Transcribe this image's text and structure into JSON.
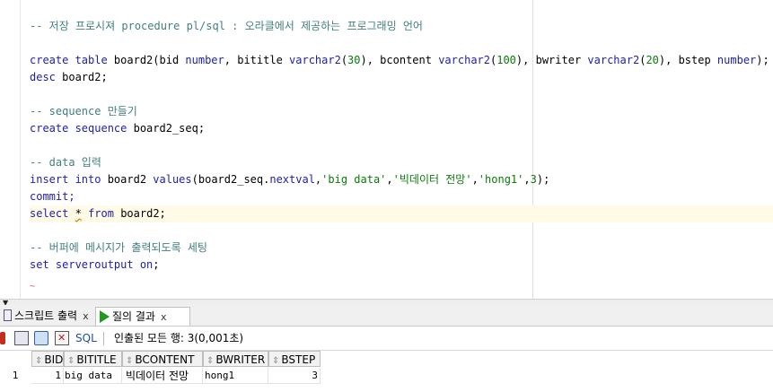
{
  "editor": {
    "lines": {
      "c1": "-- 저장 프로시져 procedure pl/sql : 오라클에서 제공하는 프로그래밍 언어",
      "l2a": "create table",
      "l2b": " board2(bid ",
      "l2c": "number",
      "l2d": ", bititle ",
      "l2e": "varchar2",
      "l2f": "(",
      "l2g": "30",
      "l2h": "), bcontent ",
      "l2i": "varchar2",
      "l2j": "(",
      "l2k": "100",
      "l2l": "), bwriter ",
      "l2m": "varchar2",
      "l2n": "(",
      "l2o": "20",
      "l2p": "), bstep ",
      "l2q": "number",
      "l2r": ");",
      "l3a": "desc",
      "l3b": " board2;",
      "c2": "-- sequence 만들기",
      "l4a": "create sequence",
      "l4b": " board2_seq;",
      "c3": "-- data 입력",
      "l5a": "insert into",
      "l5b": " board2 ",
      "l5c": "values",
      "l5d": "(board2_seq.",
      "l5e": "nextval",
      "l5f": ",",
      "l5g": "'big data'",
      "l5h": ",",
      "l5i": "'빅데이터 전망'",
      "l5j": ",",
      "l5k": "'hong1'",
      "l5l": ",",
      "l5m": "3",
      "l5n": ");",
      "l6": "commit;",
      "l7a": "select",
      "l7b": " ",
      "l7c": "*",
      "l7d": " ",
      "l7e": "from",
      "l7f": " board2;",
      "c4": "-- 버퍼에 메시지가 출력되도록 세팅",
      "l8a": "set serveroutput on",
      "l8b": ";"
    }
  },
  "tabs": {
    "script_output": "스크립트 출력",
    "query_result": "질의 결과",
    "close": "x"
  },
  "toolbar": {
    "sql_label": "SQL",
    "status": "인출된 모든 행: 3(0,001초)"
  },
  "grid": {
    "columns": [
      "BID",
      "BITITLE",
      "BCONTENT",
      "BWRITER",
      "BSTEP"
    ],
    "rows": [
      {
        "rownum": "1",
        "bid": "1",
        "bititle": "big data",
        "bcontent": "빅데이터 전망",
        "bwriter": "hong1",
        "bstep": "3"
      }
    ]
  },
  "colors": {
    "keyword": "#1e1ea8",
    "comment": "#3f7f7f",
    "number": "#0a7a0a",
    "current_line": "#fffbe6"
  }
}
